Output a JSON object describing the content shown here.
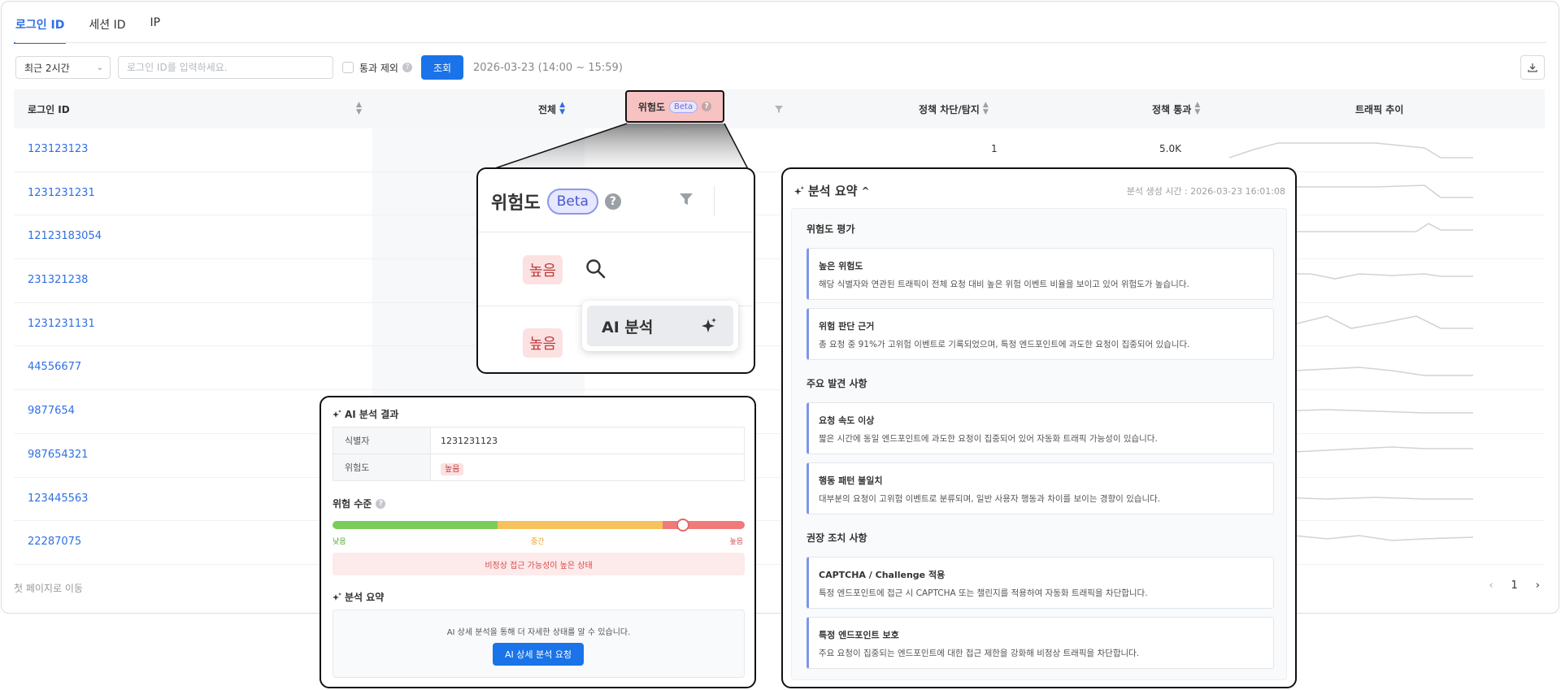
{
  "tabs": [
    "로그인 ID",
    "세션 ID",
    "IP"
  ],
  "toolbar": {
    "range_select": "최근 2시간",
    "login_placeholder": "로그인 ID를 입력하세요.",
    "exclude_pass_label": "통과 제외",
    "search_button": "조회",
    "range_text": "2026-03-23 (14:00 ~ 15:59)"
  },
  "table": {
    "headers": {
      "login_id": "로그인 ID",
      "total": "전체",
      "risk": "위험도",
      "beta": "Beta",
      "blocked": "정책 차단/탐지",
      "passed": "정책 통과",
      "trend": "트래픽 추이"
    },
    "rows": [
      {
        "id": "123123123",
        "blocked": "1",
        "passed": "5.0K"
      },
      {
        "id": "1231231231",
        "blocked": "",
        "passed": ""
      },
      {
        "id": "12123183054",
        "blocked": "",
        "passed": ""
      },
      {
        "id": "231321238",
        "blocked": "",
        "passed": ""
      },
      {
        "id": "1231231131",
        "blocked": "",
        "passed": ""
      },
      {
        "id": "44556677",
        "blocked": "",
        "passed": ""
      },
      {
        "id": "9877654",
        "blocked": "",
        "passed": ""
      },
      {
        "id": "987654321",
        "blocked": "",
        "passed": ""
      },
      {
        "id": "123445563",
        "blocked": "",
        "passed": ""
      },
      {
        "id": "22287075",
        "blocked": "",
        "passed": ""
      }
    ]
  },
  "footer": {
    "first_page": "첫 페이지로 이동",
    "page": "1"
  },
  "zoom": {
    "title": "위험도",
    "beta": "Beta",
    "tag_high": "높음",
    "ai_menu_label": "AI 분석"
  },
  "ai_result": {
    "title": "AI 분석 결과",
    "identifier_label": "식별자",
    "identifier_value": "1231231123",
    "risk_label": "위험도",
    "risk_value": "높음",
    "level_title": "위험 수준",
    "level_fraction": 0.85,
    "low": "낮음",
    "mid": "중간",
    "high": "높음",
    "warning": "비정상 접근 가능성이 높은 상태",
    "summary_title": "분석 요약",
    "summary_text": "AI 상세 분석을 통해 더 자세한 상태를 알 수 있습니다.",
    "summary_button": "AI 상세 분석 요청"
  },
  "summary_panel": {
    "title": "분석 요약",
    "generated_at": "분석 생성 시간 : 2026-03-23 16:01:08",
    "sections": [
      {
        "title": "위험도 평가",
        "cards": [
          {
            "title": "높은 위험도",
            "desc": "해당 식별자와 연관된 트래픽이 전체 요청 대비 높은 위험 이벤트 비율을 보이고 있어 위험도가 높습니다."
          },
          {
            "title": "위험 판단 근거",
            "desc": "총 요청 중 91%가 고위험 이벤트로 기록되었으며, 특정 엔드포인트에 과도한 요청이 집중되어 있습니다."
          }
        ]
      },
      {
        "title": "주요 발견 사항",
        "cards": [
          {
            "title": "요청 속도 이상",
            "desc": "짧은 시간에 동일 엔드포인트에 과도한 요청이 집중되어 있어 자동화 트래픽 가능성이 있습니다."
          },
          {
            "title": "행동 패턴 불일치",
            "desc": "대부분의 요청이 고위험 이벤트로 분류되며, 일반 사용자 행동과 차이를 보이는 경향이 있습니다."
          }
        ]
      },
      {
        "title": "권장 조치 사항",
        "cards": [
          {
            "title": "CAPTCHA / Challenge 적용",
            "desc": "특정 엔드포인트에 접근 시 CAPTCHA 또는 챌린지를 적용하여 자동화 트래픽을 차단합니다."
          },
          {
            "title": "특정 엔드포인트 보호",
            "desc": "주요 요청이 집중되는 엔드포인트에 대한 접근 제한을 강화해 비정상 트래픽을 차단합니다."
          }
        ]
      }
    ]
  },
  "colors": {
    "accent": "#1a73e8",
    "link": "#2f6fe4",
    "danger": "#c23b3b",
    "highlight": "#f7c2c2"
  }
}
